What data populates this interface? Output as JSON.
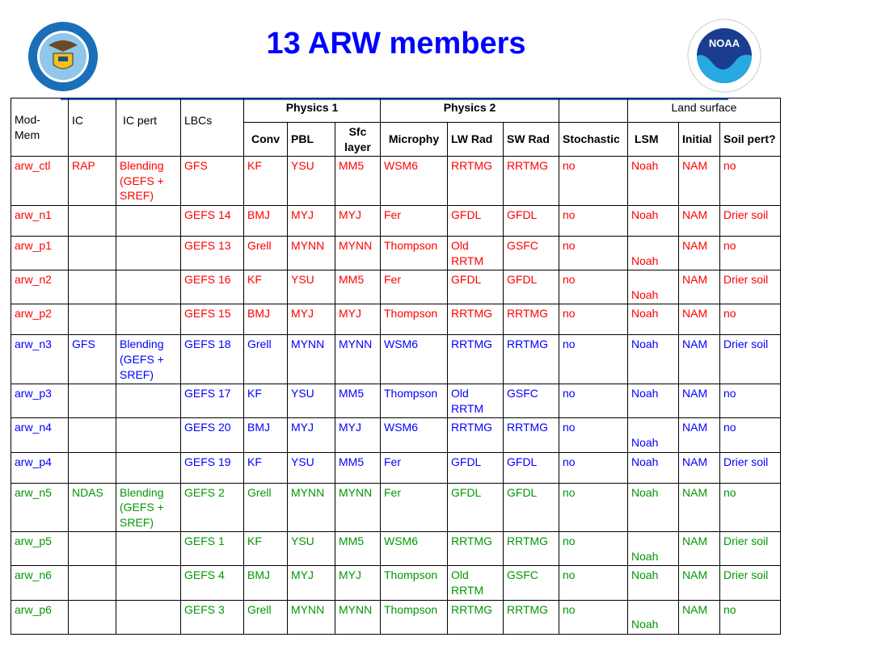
{
  "title": "13 ARW members",
  "logos": {
    "left": "United States of America Department of Commerce",
    "right": "NOAA - National Oceanic and Atmospheric Administration - U.S. Department of Commerce"
  },
  "colors": {
    "red": "#ff0000",
    "blue": "#0000ff",
    "green": "#009900",
    "title": "#0000ff"
  },
  "header": {
    "mod_mem": "Mod-\nMem",
    "ic": "IC",
    "ic_pert": "IC pert",
    "lbcs": "LBCs",
    "physics1": "Physics 1",
    "physics2": "Physics 2",
    "land_surface": "Land surface",
    "conv": "Conv",
    "pbl": "PBL",
    "sfc": "Sfc\nlayer",
    "microphy": "Microphy",
    "lw": "LW Rad",
    "sw": "SW Rad",
    "stochastic": "Stochastic",
    "lsm": "LSM",
    "initial": "Initial",
    "soil": "Soil pert?"
  },
  "rows": [
    {
      "color": "red",
      "lines": 3,
      "cells": [
        "arw_ctl",
        "RAP",
        " Blending\n(GEFS +\nSREF)",
        "GFS",
        "KF",
        "YSU",
        "MM5",
        "WSM6",
        "RRTMG",
        "RRTMG",
        "no",
        "Noah",
        "NAM",
        "no"
      ]
    },
    {
      "color": "red",
      "lines": 1,
      "cells": [
        "arw_n1",
        "",
        "",
        "GEFS 14",
        "BMJ",
        "MYJ",
        "MYJ",
        "Fer",
        "GFDL",
        "GFDL",
        "no",
        "Noah",
        "NAM",
        "Drier soil"
      ]
    },
    {
      "color": "red",
      "lines": 1,
      "cells": [
        "arw_p1",
        "",
        "",
        "GEFS 13",
        "Grell",
        "MYNN",
        "MYNN",
        "Thompson",
        "Old\nRRTM",
        "GSFC",
        "no",
        "\nNoah",
        "NAM",
        "no"
      ]
    },
    {
      "color": "red",
      "lines": 1,
      "cells": [
        "arw_n2",
        "",
        "",
        "GEFS 16",
        "KF",
        "YSU",
        "MM5",
        "Fer",
        "GFDL",
        "GFDL",
        "no",
        "\nNoah",
        "NAM",
        "Drier soil"
      ]
    },
    {
      "color": "red",
      "lines": 1,
      "cells": [
        "arw_p2",
        "",
        "",
        "GEFS 15",
        "BMJ",
        "MYJ",
        "MYJ",
        "Thompson",
        "RRTMG",
        "RRTMG",
        "no",
        "Noah",
        "NAM",
        "no"
      ]
    },
    {
      "color": "blue",
      "lines": 3,
      "cells": [
        "arw_n3",
        " GFS",
        " Blending\n(GEFS +\nSREF)",
        "GEFS 18",
        "Grell",
        "MYNN",
        "MYNN",
        "WSM6",
        "RRTMG",
        "RRTMG",
        "no",
        "Noah",
        "NAM",
        "Drier soil"
      ]
    },
    {
      "color": "blue",
      "lines": 1,
      "cells": [
        "arw_p3",
        "",
        "",
        "GEFS 17",
        "KF",
        "YSU",
        "MM5",
        "Thompson",
        "Old\nRRTM",
        "GSFC",
        "no",
        "Noah",
        "NAM",
        "no"
      ]
    },
    {
      "color": "blue",
      "lines": 1,
      "cells": [
        "arw_n4",
        "",
        "",
        "GEFS 20",
        "BMJ",
        "MYJ",
        "MYJ",
        "WSM6",
        "RRTMG",
        "RRTMG",
        "no",
        "\nNoah",
        "NAM",
        "no"
      ]
    },
    {
      "color": "blue",
      "lines": 1,
      "cells": [
        "arw_p4",
        "",
        "",
        "GEFS 19",
        "KF",
        "YSU",
        "MM5",
        "Fer",
        "GFDL",
        "GFDL",
        "no",
        "Noah",
        "NAM",
        "Drier soil"
      ]
    },
    {
      "color": "green",
      "lines": 3,
      "cells": [
        "arw_n5",
        "NDAS",
        "Blending\n(GEFS +\nSREF)",
        "GEFS 2",
        "Grell",
        "MYNN",
        "MYNN",
        "Fer",
        "GFDL",
        "GFDL",
        "no",
        "Noah",
        "NAM",
        "no"
      ]
    },
    {
      "color": "green",
      "lines": 1,
      "cells": [
        "arw_p5",
        "",
        "",
        "GEFS 1",
        "KF",
        "YSU",
        "MM5",
        "WSM6",
        "RRTMG",
        "RRTMG",
        "no",
        "\nNoah",
        "NAM",
        "Drier soil"
      ]
    },
    {
      "color": "green",
      "lines": 1,
      "cells": [
        "arw_n6",
        "",
        "",
        "GEFS 4",
        "BMJ",
        "MYJ",
        "MYJ",
        "Thompson",
        "Old\nRRTM",
        "GSFC",
        "no",
        "Noah",
        "NAM",
        "Drier soil"
      ]
    },
    {
      "color": "green",
      "lines": 1,
      "cells": [
        "arw_p6",
        "",
        "",
        "GEFS 3",
        "Grell",
        "MYNN",
        "MYNN",
        "Thompson",
        "RRTMG",
        "RRTMG",
        "no",
        "\nNoah",
        "NAM",
        "no"
      ]
    }
  ]
}
